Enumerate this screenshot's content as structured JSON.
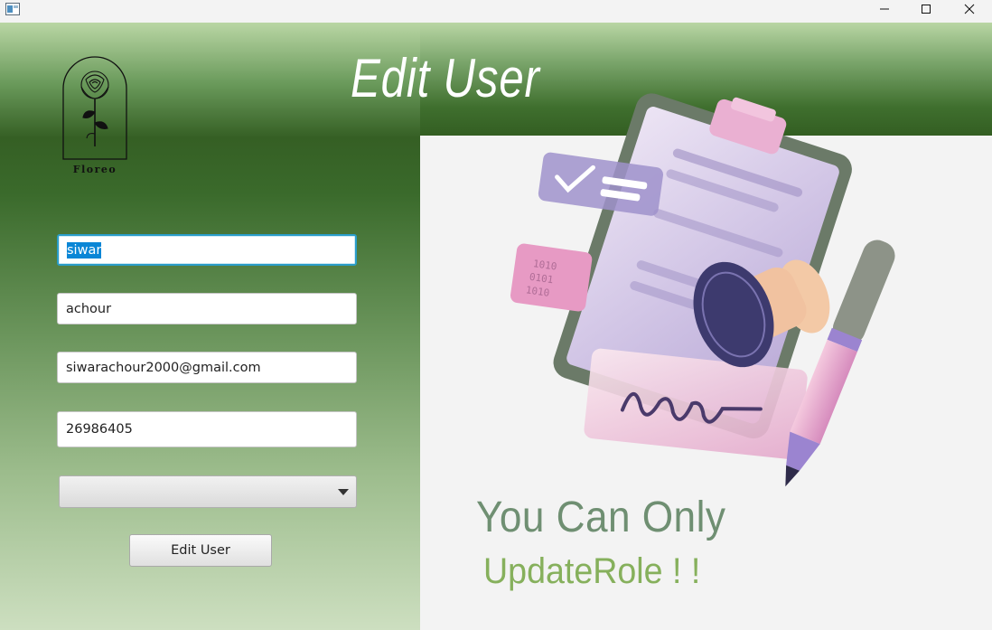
{
  "window": {
    "controls": {
      "minimize": "—",
      "maximize": "☐",
      "close": "✕"
    }
  },
  "header": {
    "title": "Edit User"
  },
  "logo": {
    "text": "Floreo",
    "icon": "rose-icon"
  },
  "form": {
    "first_name": {
      "value": "siwar",
      "selected": true
    },
    "last_name": {
      "value": "achour"
    },
    "email": {
      "value": "siwarachour2000@gmail.com"
    },
    "phone": {
      "value": "26986405"
    },
    "role": {
      "value": ""
    },
    "submit_label": "Edit User"
  },
  "message": {
    "line1": "You Can Only",
    "line2": "UpdateRole ! !"
  },
  "colors": {
    "focus": "#2a9dc9",
    "selection": "#0a86d6",
    "message1": "#6f8f72",
    "message2": "#86b05c"
  }
}
